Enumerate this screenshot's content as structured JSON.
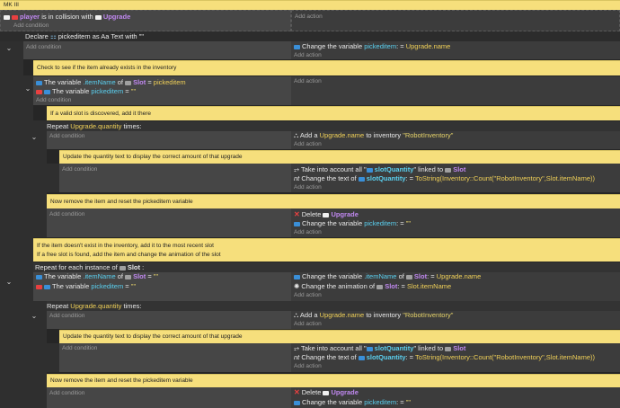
{
  "top": {
    "title": "MK III"
  },
  "row1": {
    "player": "player",
    "collision": " is in collision with ",
    "upgrade": "Upgrade",
    "add_condition": "Add condition",
    "add_action": "Add action"
  },
  "declare": {
    "prefix": "Declare ",
    "var": "pickeditem",
    "mid": " as ",
    "type": "Text with ",
    "value": "\"\""
  },
  "block1": {
    "add_condition": "Add condition",
    "act_prefix": "Change the variable ",
    "act_var": "pickeditem",
    "act_eq": ": = ",
    "act_value": "Upgrade.name",
    "add_action": "Add action"
  },
  "comment1": "Check to see if the item already exists in the inventory",
  "block2": {
    "c1_prefix": "The variable ",
    "c1_var": ".itemName",
    "c1_of": " of ",
    "c1_obj": "Slot",
    "c1_eq": " = ",
    "c1_value": "pickeditem",
    "c2_prefix": "The variable ",
    "c2_var": "pickeditem",
    "c2_eq": " = ",
    "c2_value": "\"\"",
    "add_condition": "Add condition",
    "add_action": "Add action"
  },
  "comment2": "If a valid slot is discovered, add it there",
  "repeat1": {
    "label": "Repeat ",
    "expr": "Upgrade.quantity",
    "tail": " times:"
  },
  "block3": {
    "add_condition": "Add condition",
    "act_prefix": "Add a ",
    "act_expr": "Upgrade.name",
    "act_mid": " to inventory ",
    "act_str": "\"RobotInventory\"",
    "add_action": "Add action"
  },
  "comment3": "Update the quantity text to display the correct amount of that upgrade",
  "block4": {
    "add_condition": "Add condition",
    "a1_prefix": "Take into account all \"",
    "a1_var": "slotQuantity",
    "a1_mid": "\" linked to ",
    "a1_obj": "Slot",
    "a2_prefix": "Change the text of ",
    "a2_var": "slotQuantity",
    "a2_eq": ": = ",
    "a2_value": "ToString(Inventory::Count(\"RobotInventory\",Slot.itemName))",
    "add_action": "Add action"
  },
  "comment4": "Now remove the item and reset the pickeditem variable",
  "block5": {
    "add_condition": "Add condition",
    "a1_prefix": "Delete ",
    "a1_obj": "Upgrade",
    "a2_prefix": "Change the variable ",
    "a2_var": "pickeditem",
    "a2_eq": ": = ",
    "a2_value": "\"\"",
    "add_action": "Add action"
  },
  "comment5": {
    "line1": "If the item doesn't exist in the inventory, add it to the most recent slot",
    "line2": "If a free slot is found, add the item and change the animation of the slot"
  },
  "foreach": {
    "label": "Repeat for each instance of ",
    "obj": "Slot",
    "tail": " :"
  },
  "block6": {
    "c1_prefix": "The variable ",
    "c1_var": ".itemName",
    "c1_of": " of ",
    "c1_obj": "Slot",
    "c1_eq": " = ",
    "c1_value": "\"\"",
    "c2_prefix": "The variable ",
    "c2_var": "pickeditem",
    "c2_eq": " = ",
    "c2_value": "\"\"",
    "a1_prefix": "Change the variable ",
    "a1_var": ".itemName",
    "a1_of": " of ",
    "a1_obj": "Slot",
    "a1_eq": ": = ",
    "a1_value": "Upgrade.name",
    "a2_prefix": "Change the animation of ",
    "a2_obj": "Slot",
    "a2_eq": ": = ",
    "a2_value": "Slot.itemName",
    "add_action": "Add action"
  },
  "repeat2": {
    "label": "Repeat ",
    "expr": "Upgrade.quantity",
    "tail": " times:"
  },
  "block7": {
    "add_condition": "Add condition",
    "act_prefix": "Add a ",
    "act_expr": "Upgrade.name",
    "act_mid": " to inventory ",
    "act_str": "\"RobotInventory\"",
    "add_action": "Add action"
  },
  "comment6": "Update the quantity text to display the correct amount of that upgrade",
  "block8": {
    "add_condition": "Add condition",
    "a1_prefix": "Take into account all \"",
    "a1_var": "slotQuantity",
    "a1_mid": "\" linked to ",
    "a1_obj": "Slot",
    "a2_prefix": "Change the text of ",
    "a2_var": "slotQuantity",
    "a2_eq": ": = ",
    "a2_value": "ToString(Inventory::Count(\"RobotInventory\",Slot.itemName))",
    "add_action": "Add action"
  },
  "comment7": "Now remove the item and reset the pickeditem variable",
  "block9": {
    "add_condition": "Add condition",
    "a1_prefix": "Delete ",
    "a1_obj": "Upgrade",
    "a2_prefix": "Change the variable ",
    "a2_var": "pickeditem",
    "a2_eq": ": = ",
    "a2_value": "\"\""
  }
}
